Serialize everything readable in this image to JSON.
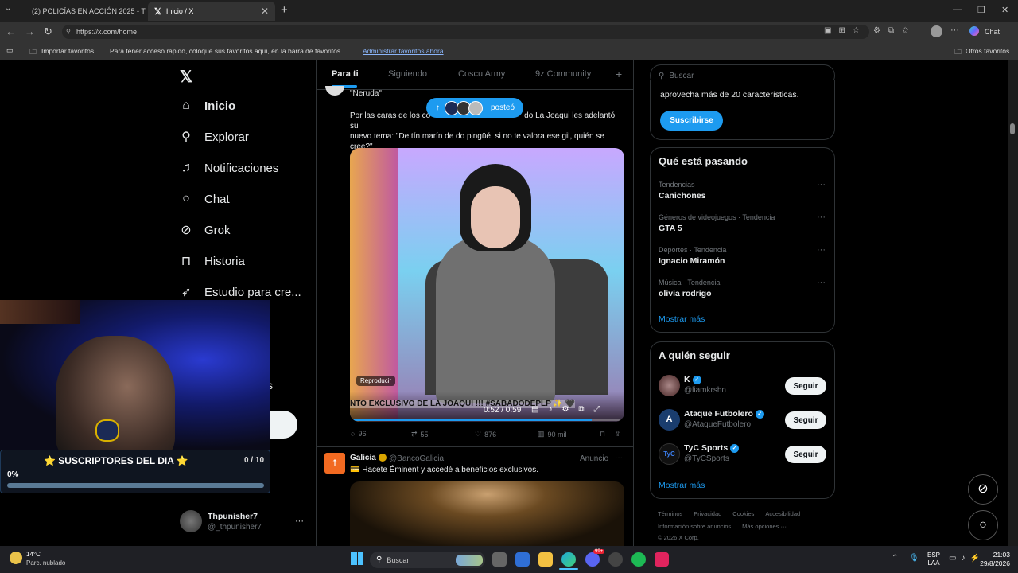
{
  "browser": {
    "tabs": [
      {
        "title": "(2) POLICÍAS EN ACCIÓN 2025 - T"
      },
      {
        "title": "Inicio / X"
      }
    ],
    "url": "https://x.com/home",
    "favbar": {
      "import": "Importar favoritos",
      "hint": "Para tener acceso rápido, coloque sus favoritos aquí, en la barra de favoritos.",
      "manage": "Administrar favoritos ahora",
      "others": "Otros favoritos"
    },
    "chat_label": "Chat"
  },
  "sidebar": {
    "items": [
      {
        "label": "Inicio",
        "icon": "home-icon"
      },
      {
        "label": "Explorar",
        "icon": "search-icon"
      },
      {
        "label": "Notificaciones",
        "icon": "bell-icon"
      },
      {
        "label": "Chat",
        "icon": "chat-icon"
      },
      {
        "label": "Grok",
        "icon": "grok-icon"
      },
      {
        "label": "Historia",
        "icon": "bookmark-icon"
      },
      {
        "label": "Estudio para cre...",
        "icon": "rocket-icon"
      }
    ],
    "partial_s": "s",
    "user": {
      "name": "Thpunisher7",
      "handle": "@_thpunisher7"
    }
  },
  "overlay": {
    "title": "⭐ SUSCRIPTORES DEL DIA ⭐",
    "count": "0 / 10",
    "percent": "0%",
    "progress": 0
  },
  "feed": {
    "tabs": [
      "Para ti",
      "Siguiendo",
      "Coscu Army",
      "9z Community",
      "+"
    ],
    "posted_pill": "posteó",
    "post": {
      "quote": "\"Neruda\"",
      "text_a": "Por las caras de los co",
      "text_b": "do La Joaqui les adelantó su",
      "text_c": "nuevo tema: \"De tín marín de do pingüé, si no te valora ese gil, quién se",
      "text_d": "cree?\"",
      "video_badge": "Reproducir",
      "video_caption": "NTO EXCLUSIVO DE LA JOAQUI !!! #SABADODEPLP ✨ 🖤",
      "video_time": "0:52 / 0:59",
      "video_progress": 0.88,
      "stats": {
        "replies": "96",
        "reposts": "55",
        "likes": "876",
        "views": "90 mil"
      }
    },
    "ad": {
      "name": "Galicia",
      "handle": "@BancoGalicia",
      "label": "Anuncio",
      "text": "💳 Hacete Éminent y accedé a beneficios exclusivos."
    }
  },
  "right": {
    "search_placeholder": "Buscar",
    "premium": {
      "text": "aprovecha más de 20 características.",
      "button": "Suscribirse"
    },
    "trends": {
      "title": "Qué está pasando",
      "items": [
        {
          "category": "Tendencias",
          "name": "Canichones"
        },
        {
          "category": "Géneros de videojuegos · Tendencia",
          "name": "GTA 5"
        },
        {
          "category": "Deportes · Tendencia",
          "name": "Ignacio Miramón"
        },
        {
          "category": "Música · Tendencia",
          "name": "olivia rodrigo"
        }
      ],
      "more": "Mostrar más"
    },
    "follow": {
      "title": "A quién seguir",
      "items": [
        {
          "name": "K",
          "handle": "@liamkrshn",
          "button": "Seguir"
        },
        {
          "name": "Ataque Futbolero",
          "handle": "@AtaqueFutbolero",
          "button": "Seguir"
        },
        {
          "name": "TyC Sports",
          "handle": "@TyCSports",
          "button": "Seguir"
        }
      ],
      "more": "Mostrar más"
    },
    "footer": {
      "l1": [
        "Términos",
        "Privacidad",
        "Cookies",
        "Accesibilidad"
      ],
      "l2": [
        "Información sobre anuncios",
        "Más opciones ···"
      ],
      "copy": "© 2026 X Corp."
    }
  },
  "taskbar": {
    "weather_temp": "14°C",
    "weather_desc": "Parc. nublado",
    "search": "Buscar",
    "lang1": "ESP",
    "lang2": "LAA",
    "time": "21:03",
    "date": "29/8/2026",
    "badge_count": "99+"
  }
}
